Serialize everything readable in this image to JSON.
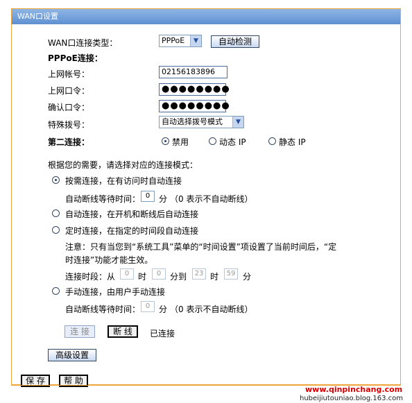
{
  "title": "WAN口设置",
  "conn_type": {
    "label": "WAN口连接类型：",
    "value": "PPPoE",
    "auto_detect": "自动检测"
  },
  "pppoe_header": "PPPoE连接：",
  "account": {
    "label": "上网帐号：",
    "value": "02156183896"
  },
  "password": {
    "label": "上网口令：",
    "value": "●●●●●●●●"
  },
  "confirm": {
    "label": "确认口令：",
    "value": "●●●●●●●●"
  },
  "dial": {
    "label": "特殊拨号：",
    "value": "自动选择拨号模式"
  },
  "second": {
    "label": "第二连接：",
    "options": [
      "禁用",
      "动态 IP",
      "静态 IP"
    ],
    "selected": 0
  },
  "mode_prompt": "根据您的需要，请选择对应的连接模式：",
  "mode1": {
    "label": "按需连接，在有访问时自动连接",
    "wait_label": "自动断线等待时间：",
    "wait_value": "0",
    "unit": "分",
    "note": "（0 表示不自动断线）"
  },
  "mode2": {
    "label": "自动连接，在开机和断线后自动连接"
  },
  "mode3": {
    "label": "定时连接，在指定的时间段自动连接",
    "note_line1": "注意：只有当您到“系统工具”菜单的“时间设置”项设置了当前时间后，“定",
    "note_line2": "时连接”功能才能生效。",
    "period_label": "连接时段：从",
    "from_h": "0",
    "hour": "时",
    "from_m": "0",
    "to_label": "分到",
    "to_h": "23",
    "to_m": "59",
    "min": "分"
  },
  "mode4": {
    "label": "手动连接，由用户手动连接",
    "wait_label": "自动断线等待时间：",
    "wait_value": "0",
    "unit": "分",
    "note": "（0 表示不自动断线）"
  },
  "buttons": {
    "connect": "连 接",
    "disconnect": "断 线",
    "status": "已连接",
    "advanced": "高级设置",
    "save": "保 存",
    "help": "帮 助"
  },
  "watermark": {
    "site": "www.qinpinchang.com",
    "blog": "hubeijiutouniao.blog.163.com"
  }
}
